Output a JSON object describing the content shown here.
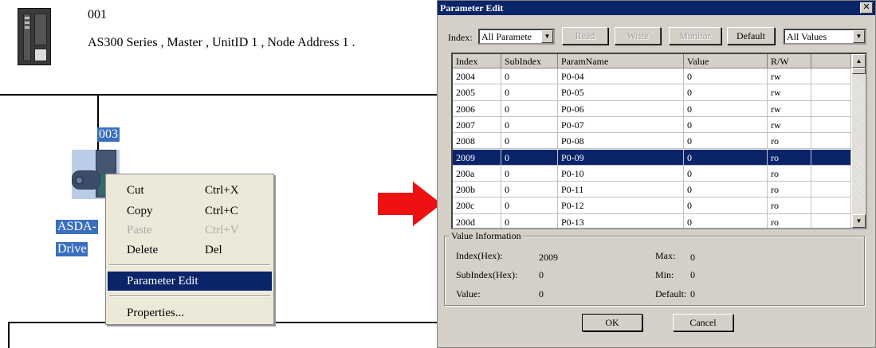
{
  "network": {
    "master": {
      "id": "001",
      "description": "AS300 Series , Master , UnitID 1 , Node Address 1 ."
    },
    "slave": {
      "id": "003",
      "name_line1": "ASDA-",
      "name_line2": "Drive"
    }
  },
  "context_menu": {
    "items": [
      {
        "label": "Cut",
        "shortcut": "Ctrl+X",
        "enabled": true
      },
      {
        "label": "Copy",
        "shortcut": "Ctrl+C",
        "enabled": true
      },
      {
        "label": "Paste",
        "shortcut": "Ctrl+V",
        "enabled": false
      },
      {
        "label": "Delete",
        "shortcut": "Del",
        "enabled": true
      },
      {
        "label": "Parameter Edit",
        "shortcut": "",
        "enabled": true,
        "highlighted": true
      },
      {
        "label": "Properties...",
        "shortcut": "",
        "enabled": true
      }
    ]
  },
  "dialog": {
    "title": "Parameter Edit",
    "close_icon": "close-icon",
    "index_label": "Index:",
    "index_value": "All Paramete",
    "read": "Read",
    "write": "Write",
    "monitor": "Monitor",
    "default": "Default",
    "filter_value": "All Values",
    "columns": [
      "Index",
      "SubIndex",
      "ParamName",
      "Value",
      "R/W"
    ],
    "rows": [
      [
        "2004",
        "0",
        "P0-04",
        "0",
        "rw"
      ],
      [
        "2005",
        "0",
        "P0-05",
        "0",
        "rw"
      ],
      [
        "2006",
        "0",
        "P0-06",
        "0",
        "rw"
      ],
      [
        "2007",
        "0",
        "P0-07",
        "0",
        "rw"
      ],
      [
        "2008",
        "0",
        "P0-08",
        "0",
        "ro"
      ],
      [
        "2009",
        "0",
        "P0-09",
        "0",
        "ro"
      ],
      [
        "200a",
        "0",
        "P0-10",
        "0",
        "ro"
      ],
      [
        "200b",
        "0",
        "P0-11",
        "0",
        "ro"
      ],
      [
        "200c",
        "0",
        "P0-12",
        "0",
        "ro"
      ],
      [
        "200d",
        "0",
        "P0-13",
        "0",
        "ro"
      ]
    ],
    "selected_row": 5,
    "value_info": {
      "legend": "Value Information",
      "index_hex_label": "Index(Hex):",
      "index_hex_value": "2009",
      "subindex_hex_label": "SubIndex(Hex):",
      "subindex_hex_value": "0",
      "value_label": "Value:",
      "value_value": "0",
      "max_label": "Max:",
      "max_value": "0",
      "min_label": "Min:",
      "min_value": "0",
      "default_label": "Default:",
      "default_value": "0"
    },
    "ok": "OK",
    "cancel": "Cancel"
  },
  "colors": {
    "arrow": "#ee1111",
    "selection": "#0a246a",
    "dialog_bg": "#d4d0c8"
  }
}
